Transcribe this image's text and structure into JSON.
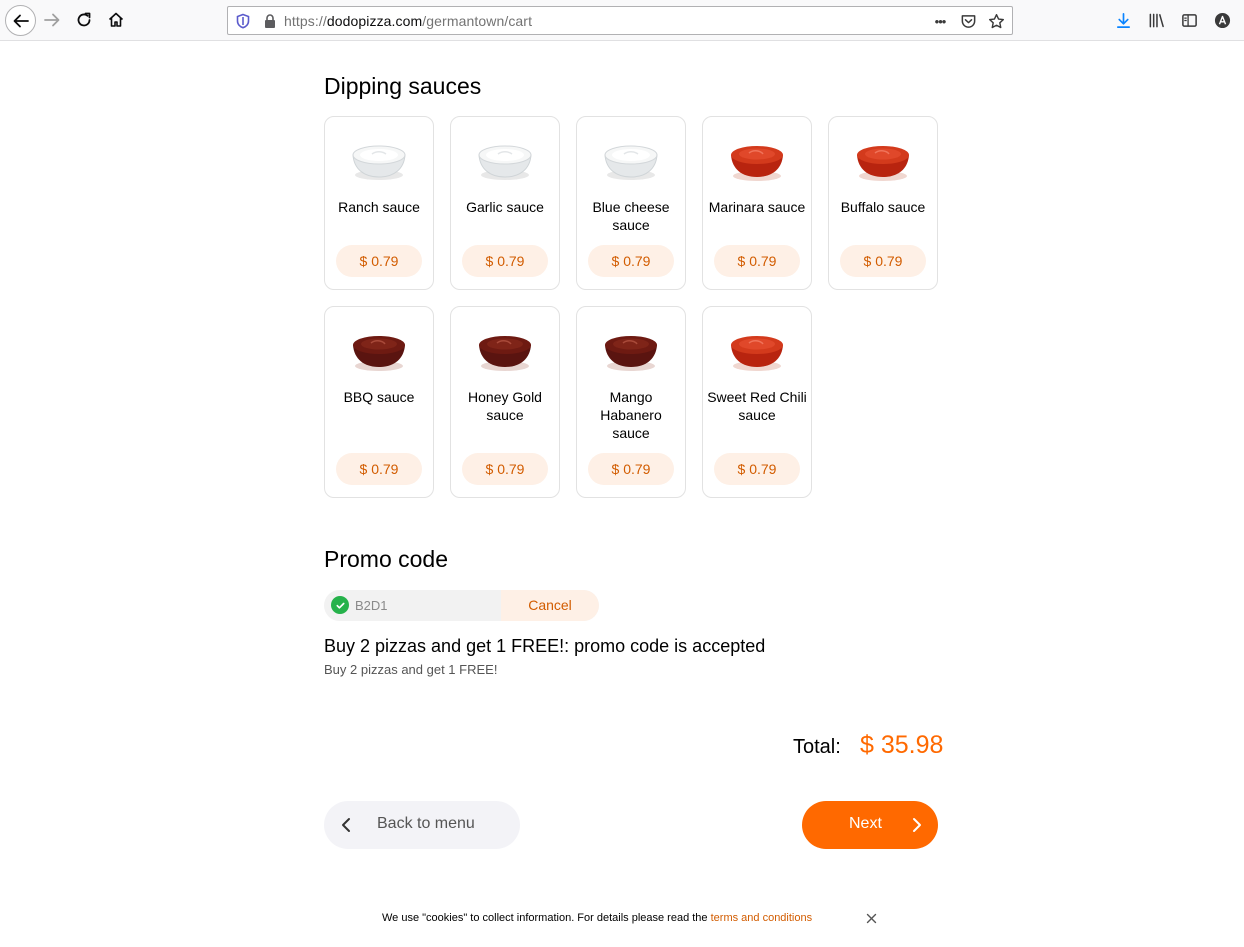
{
  "browser": {
    "url_prefix": "https://",
    "url_host": "dodopizza.com",
    "url_path": "/germantown/cart",
    "page_actions_glyph": "•••"
  },
  "sections": {
    "sauces_title": "Dipping sauces",
    "promo_title": "Promo code"
  },
  "sauces": [
    {
      "name": "Ranch sauce",
      "price": "$ 0.79",
      "kind": "white"
    },
    {
      "name": "Garlic sauce",
      "price": "$ 0.79",
      "kind": "white"
    },
    {
      "name": "Blue cheese sauce",
      "price": "$ 0.79",
      "kind": "white"
    },
    {
      "name": "Marinara sauce",
      "price": "$ 0.79",
      "kind": "red"
    },
    {
      "name": "Buffalo sauce",
      "price": "$ 0.79",
      "kind": "red"
    },
    {
      "name": "BBQ sauce",
      "price": "$ 0.79",
      "kind": "brown"
    },
    {
      "name": "Honey Gold sauce",
      "price": "$ 0.79",
      "kind": "brown"
    },
    {
      "name": "Mango Habanero sauce",
      "price": "$ 0.79",
      "kind": "brown"
    },
    {
      "name": "Sweet Red Chili sauce",
      "price": "$ 0.79",
      "kind": "red"
    }
  ],
  "promo": {
    "code": "B2D1",
    "cancel_label": "Cancel",
    "message": "Buy 2 pizzas and get 1 FREE!: promo code is accepted",
    "description": "Buy 2 pizzas and get 1 FREE!"
  },
  "total": {
    "label": "Total:",
    "value": "$ 35.98"
  },
  "buttons": {
    "back_label": "Back to menu",
    "next_label": "Next"
  },
  "cookie": {
    "text": "We use \"cookies\" to collect information. For details please read the ",
    "link": "terms and conditions"
  },
  "colors": {
    "accent": "#ff6900",
    "price_text": "#d25c00",
    "price_bg": "#fef0e6",
    "success": "#26b24b"
  }
}
